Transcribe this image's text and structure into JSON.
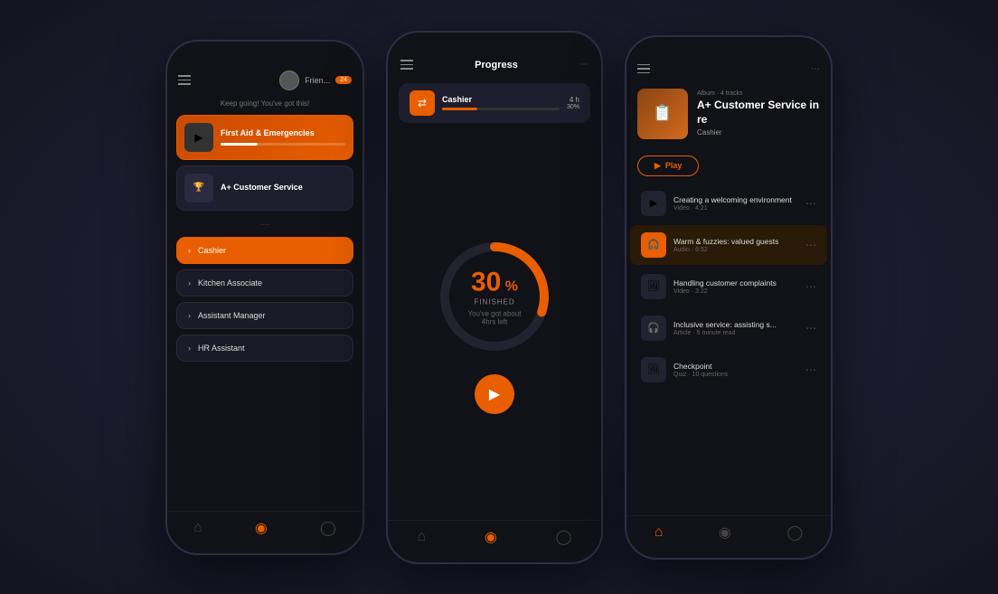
{
  "phone1": {
    "header": {
      "user_label": "Frien...",
      "badge": "24"
    },
    "keep_going": "Keep going! You've got this!",
    "courses": [
      {
        "id": "first-aid",
        "title": "First Aid & Emergencies",
        "progress": 30,
        "thumb_emoji": "▶"
      },
      {
        "id": "customer-service",
        "title": "A+ Customer Service",
        "progress": 0,
        "thumb_emoji": "🏆"
      }
    ],
    "roles": [
      {
        "id": "cashier",
        "label": "Cashier",
        "selected": true
      },
      {
        "id": "kitchen",
        "label": "Kitchen Associate",
        "selected": false
      },
      {
        "id": "assistant-manager",
        "label": "Assistant Manager",
        "selected": false
      },
      {
        "id": "hr-assistant",
        "label": "HR Assistant",
        "selected": false
      }
    ]
  },
  "phone2": {
    "header_title": "Progress",
    "course": {
      "name": "Cashier",
      "hours": "4 h",
      "percent": "30%",
      "progress": 30
    },
    "circle": {
      "percent": 30,
      "label": "FINISHED",
      "subtitle": "You've got about 4hrs left"
    }
  },
  "phone3": {
    "album": {
      "meta": "Album · 4 tracks",
      "title": "A+ Customer Service in re",
      "subtitle": "Cashier",
      "thumb_emoji": "📋"
    },
    "play_label": "Play",
    "tracks": [
      {
        "id": "t1",
        "name": "Creating a welcoming environment",
        "meta": "Video · 4:21",
        "icon": "▶",
        "type": "video",
        "playing": false
      },
      {
        "id": "t2",
        "name": "Warm & fuzzies: valued guests",
        "meta": "Audio · 6:52",
        "icon": "🎧",
        "type": "audio",
        "playing": true
      },
      {
        "id": "t3",
        "name": "Handling customer complaints",
        "meta": "Video · 3:22",
        "icon": "🖼",
        "type": "video",
        "playing": false
      },
      {
        "id": "t4",
        "name": "Inclusive service: assisting s...",
        "meta": "Article · 5 minute read",
        "icon": "🎧",
        "type": "article",
        "playing": false
      },
      {
        "id": "t5",
        "name": "Checkpoint",
        "meta": "Quiz · 10 questions",
        "icon": "🖼",
        "type": "quiz",
        "playing": false
      }
    ]
  }
}
